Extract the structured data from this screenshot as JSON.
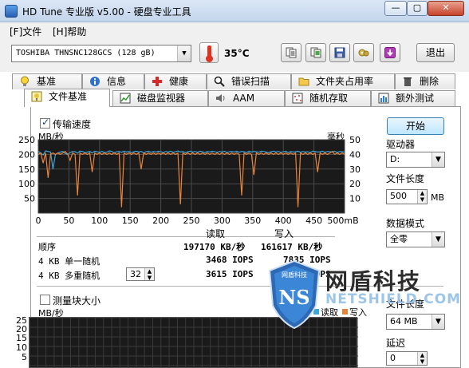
{
  "window": {
    "title": "HD Tune 专业版 v5.00 - 硬盘专业工具",
    "min": "—",
    "max": "▢",
    "close": "✕"
  },
  "menu": {
    "file": "[F]文件",
    "help": "[H]帮助"
  },
  "toolbar": {
    "drive": "TOSHIBA THNSNC128GCS    (128 gB)",
    "temperature": "35°C",
    "exit_label": "退出",
    "icons": [
      "copy-text-icon",
      "copy-screenshot-icon",
      "save-icon",
      "options-icon",
      "download-icon"
    ]
  },
  "tabs_top": [
    {
      "label": "基准",
      "icon": "lightbulb-icon"
    },
    {
      "label": "信息",
      "icon": "info-icon"
    },
    {
      "label": "健康",
      "icon": "health-cross-icon"
    },
    {
      "label": "错误扫描",
      "icon": "magnifier-icon"
    },
    {
      "label": "文件夹占用率",
      "icon": "folder-icon"
    },
    {
      "label": "删除",
      "icon": "trash-icon"
    }
  ],
  "tabs_bottom": [
    {
      "label": "文件基准",
      "icon": "file-benchmark-icon",
      "active": true
    },
    {
      "label": "磁盘监视器",
      "icon": "monitor-chart-icon"
    },
    {
      "label": "AAM",
      "icon": "speaker-icon"
    },
    {
      "label": "随机存取",
      "icon": "random-access-icon"
    },
    {
      "label": "额外测试",
      "icon": "extra-tests-icon"
    }
  ],
  "transfer": {
    "checkbox_label": "传输速度",
    "checked": true,
    "y_unit_left": "MB/秒",
    "y_unit_right": "毫秒"
  },
  "results": {
    "col_read": "读取",
    "col_write": "写入",
    "rows": [
      {
        "label": "顺序",
        "read": "197170 KB/秒",
        "write": "161617 KB/秒"
      },
      {
        "label": "4 KB 单一随机",
        "read": "3468 IOPS",
        "write": "7835 IOPS"
      },
      {
        "label": "4 KB 多重随机",
        "queue": "32",
        "read": "3615 IOPS",
        "write": "7840 IOPS"
      }
    ]
  },
  "right_panel": {
    "start_label": "开始",
    "drive_label": "驱动器",
    "drive_value": "D:",
    "file_length_label": "文件长度",
    "file_length_value": "500",
    "file_length_unit": "MB",
    "data_mode_label": "数据模式",
    "data_mode_value": "全零"
  },
  "block": {
    "checkbox_label": "测量块大小",
    "checked": false,
    "y_unit": "MB/秒",
    "legend_read": "读取",
    "legend_write": "写入",
    "file_length_label": "文件长度",
    "file_length_value": "64 MB",
    "delay_label": "延迟",
    "delay_value": "0",
    "y_ticks": [
      "25",
      "20",
      "15",
      "10",
      "5"
    ]
  },
  "watermark": {
    "cn": "网盾科技",
    "en": "NETSHIELD.COM",
    "seal": "NS",
    "seal_text": "网盾科技"
  },
  "colors": {
    "read": "#3aa6dc",
    "write": "#e8843a",
    "plot_bg": "#1a1a1a",
    "grid": "#4a4a4a"
  },
  "chart_data": {
    "type": "line",
    "title": "",
    "xlabel": "",
    "ylabel": "MB/秒",
    "y2label": "毫秒",
    "xlim": [
      0,
      500
    ],
    "ylim": [
      0,
      250
    ],
    "y2lim": [
      0,
      50
    ],
    "x_ticks": [
      "0",
      "50",
      "100",
      "150",
      "200",
      "250",
      "300",
      "350",
      "400",
      "450",
      "500mB"
    ],
    "y_ticks": [
      "250",
      "200",
      "150",
      "100",
      "50"
    ],
    "y2_ticks": [
      "50",
      "40",
      "30",
      "20",
      "10"
    ],
    "grid": true,
    "series": [
      {
        "color": "#3aa6dc",
        "x": [
          0,
          4,
          8,
          12,
          16,
          20,
          24,
          28,
          32,
          36,
          40,
          44,
          48,
          52,
          56,
          60,
          64,
          68,
          72,
          76,
          80,
          84,
          88,
          92,
          96,
          100,
          104,
          108,
          112,
          116,
          120,
          124,
          128,
          132,
          136,
          140,
          144,
          148,
          152,
          156,
          160,
          164,
          168,
          172,
          176,
          180,
          184,
          188,
          192,
          196,
          200,
          204,
          208,
          212,
          216,
          220,
          224,
          228,
          232,
          236,
          240,
          244,
          248,
          252,
          256,
          260,
          264,
          268,
          272,
          276,
          280,
          284,
          288,
          292,
          296,
          300,
          304,
          308,
          312,
          316,
          320,
          324,
          328,
          332,
          336,
          340,
          344,
          348,
          352,
          356,
          360,
          364,
          368,
          372,
          376,
          380,
          384,
          388,
          392,
          396,
          400,
          404,
          408,
          412,
          416,
          420,
          424,
          428,
          432,
          436,
          440,
          444,
          448,
          452,
          456,
          460,
          464,
          468,
          472,
          476,
          480,
          484,
          488,
          492,
          496,
          500
        ],
        "values": [
          210,
          205,
          198,
          212,
          210,
          208,
          150,
          200,
          205,
          208,
          210,
          203,
          200,
          206,
          210,
          209,
          204,
          211,
          210,
          206,
          208,
          210,
          205,
          211,
          209,
          207,
          210,
          206,
          208,
          212,
          210,
          205,
          209,
          210,
          207,
          211,
          208,
          210,
          206,
          209,
          211,
          208,
          210,
          205,
          209,
          211,
          207,
          210,
          208,
          211,
          209,
          206,
          210,
          208,
          211,
          207,
          209,
          212,
          208,
          210,
          206,
          209,
          211,
          208,
          210,
          207,
          211,
          209,
          206,
          210,
          208,
          211,
          209,
          207,
          210,
          208,
          211,
          206,
          209,
          210,
          208,
          211,
          207,
          210,
          209,
          206,
          211,
          208,
          210,
          209,
          207,
          211,
          210,
          208,
          206,
          209,
          211,
          208,
          210,
          207,
          209,
          211,
          206,
          210,
          208,
          209,
          211,
          207,
          210,
          208,
          209,
          206,
          211,
          210,
          208,
          209,
          211,
          207,
          210,
          209,
          208,
          211,
          206,
          210,
          209,
          208
        ]
      },
      {
        "color": "#e8843a",
        "x": [
          0,
          4,
          8,
          12,
          16,
          20,
          24,
          28,
          32,
          36,
          40,
          44,
          48,
          52,
          56,
          60,
          64,
          68,
          72,
          76,
          80,
          84,
          88,
          92,
          96,
          100,
          104,
          108,
          112,
          116,
          120,
          124,
          128,
          132,
          136,
          140,
          144,
          148,
          152,
          156,
          160,
          164,
          168,
          172,
          176,
          180,
          184,
          188,
          192,
          196,
          200,
          204,
          208,
          212,
          216,
          220,
          224,
          228,
          232,
          236,
          240,
          244,
          248,
          252,
          256,
          260,
          264,
          268,
          272,
          276,
          280,
          284,
          288,
          292,
          296,
          300,
          304,
          308,
          312,
          316,
          320,
          324,
          328,
          332,
          336,
          340,
          344,
          348,
          352,
          356,
          360,
          364,
          368,
          372,
          376,
          380,
          384,
          388,
          392,
          396,
          400,
          404,
          408,
          412,
          416,
          420,
          424,
          428,
          432,
          436,
          440,
          444,
          448,
          452,
          456,
          460,
          464,
          468,
          472,
          476,
          480,
          484,
          488,
          492,
          496,
          500
        ],
        "values": [
          200,
          205,
          170,
          205,
          120,
          200,
          205,
          200,
          205,
          200,
          205,
          210,
          200,
          180,
          205,
          200,
          60,
          205,
          200,
          205,
          200,
          205,
          140,
          205,
          200,
          205,
          200,
          205,
          200,
          205,
          200,
          205,
          200,
          205,
          20,
          205,
          200,
          205,
          200,
          205,
          200,
          205,
          150,
          205,
          200,
          205,
          200,
          205,
          200,
          205,
          200,
          205,
          200,
          205,
          200,
          205,
          200,
          205,
          30,
          205,
          200,
          205,
          200,
          205,
          200,
          205,
          200,
          205,
          200,
          205,
          200,
          205,
          200,
          205,
          200,
          205,
          200,
          205,
          200,
          205,
          200,
          205,
          200,
          60,
          205,
          200,
          205,
          200,
          130,
          205,
          200,
          205,
          200,
          205,
          200,
          205,
          200,
          205,
          200,
          205,
          200,
          205,
          200,
          205,
          200,
          205,
          20,
          205,
          200,
          205,
          200,
          205,
          200,
          205,
          140,
          205,
          200,
          205,
          200,
          205,
          210,
          200,
          205,
          200,
          205,
          200
        ]
      }
    ]
  }
}
